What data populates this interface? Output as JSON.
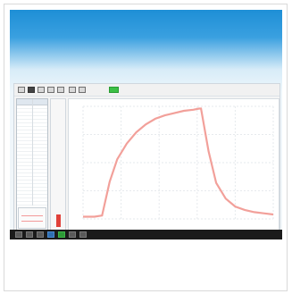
{
  "app": {
    "accent_color": "#3cbf45",
    "curve_color": "#f2a09a",
    "toolbar_icons": [
      "open-icon",
      "save-icon",
      "print-icon",
      "zoom-icon",
      "settings-icon",
      "chart-icon",
      "curve-icon",
      "start-icon"
    ]
  },
  "graph": {
    "type": "line",
    "grid": true,
    "title": "",
    "xlabel": "",
    "ylabel": ""
  },
  "chart_data": {
    "type": "line",
    "series": [
      {
        "values_x": [
          0.0,
          0.06,
          0.1,
          0.14,
          0.18,
          0.23,
          0.28,
          0.33,
          0.38,
          0.43,
          0.48,
          0.53,
          0.58,
          0.61,
          0.62,
          0.66,
          0.7,
          0.75,
          0.8,
          0.85,
          0.9,
          0.95,
          1.0
        ],
        "values_y": [
          0.02,
          0.02,
          0.03,
          0.33,
          0.53,
          0.67,
          0.77,
          0.84,
          0.89,
          0.92,
          0.94,
          0.96,
          0.97,
          0.98,
          0.98,
          0.6,
          0.32,
          0.18,
          0.11,
          0.08,
          0.06,
          0.05,
          0.04
        ]
      }
    ],
    "xlim": [
      0,
      1
    ],
    "ylim": [
      0,
      1
    ],
    "grid": true
  }
}
